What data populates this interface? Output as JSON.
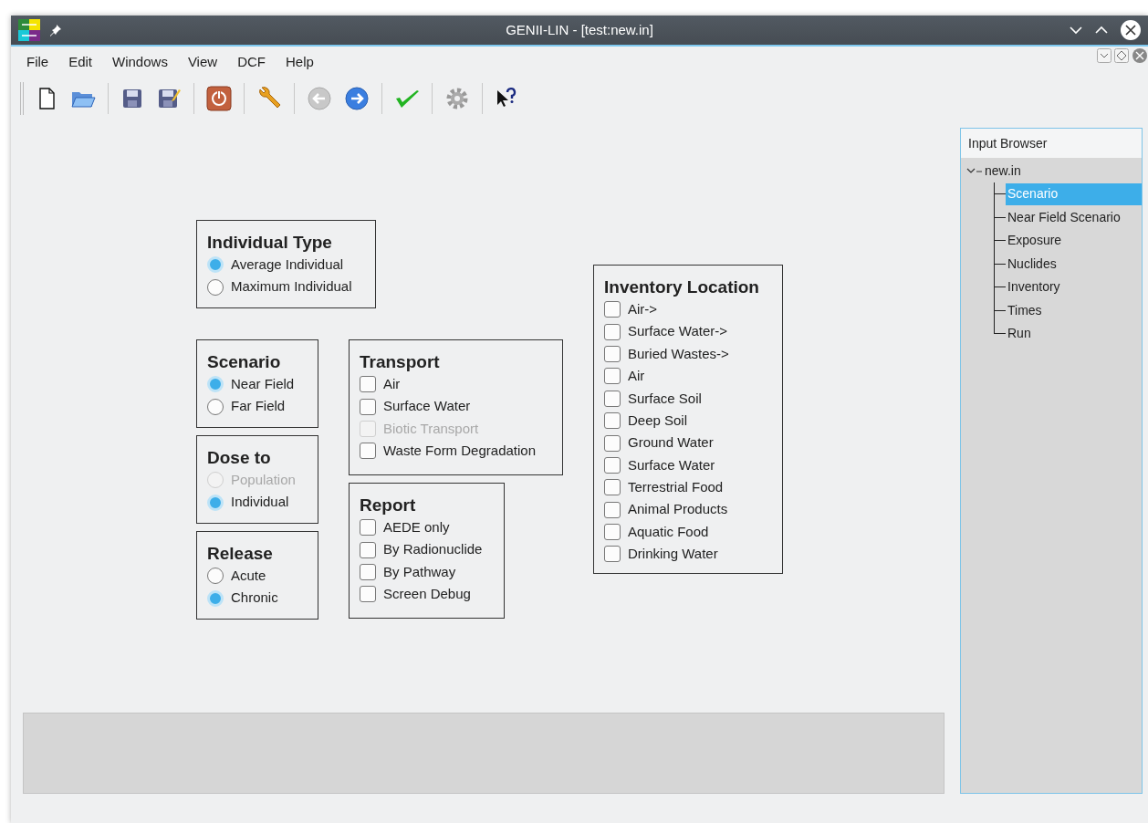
{
  "window": {
    "title": "GENII-LIN - [test:new.in]"
  },
  "menu": [
    "File",
    "Edit",
    "Windows",
    "View",
    "DCF",
    "Help"
  ],
  "groups": [
    {
      "title": "Individual Type",
      "kind": "radio",
      "options": [
        {
          "label": "Average Individual",
          "selected": true,
          "disabled": false
        },
        {
          "label": "Maximum Individual",
          "selected": false,
          "disabled": false
        }
      ]
    },
    {
      "title": "Scenario",
      "kind": "radio",
      "options": [
        {
          "label": "Near Field",
          "selected": true,
          "disabled": false
        },
        {
          "label": "Far Field",
          "selected": false,
          "disabled": false
        }
      ]
    },
    {
      "title": "Dose to",
      "kind": "radio",
      "options": [
        {
          "label": "Population",
          "selected": false,
          "disabled": true
        },
        {
          "label": "Individual",
          "selected": true,
          "disabled": false
        }
      ]
    },
    {
      "title": "Release",
      "kind": "radio",
      "options": [
        {
          "label": "Acute",
          "selected": false,
          "disabled": false
        },
        {
          "label": "Chronic",
          "selected": true,
          "disabled": false
        }
      ]
    },
    {
      "title": "Transport",
      "kind": "checkbox",
      "options": [
        {
          "label": "Air",
          "checked": false,
          "disabled": false
        },
        {
          "label": "Surface Water",
          "checked": false,
          "disabled": false
        },
        {
          "label": "Biotic Transport",
          "checked": false,
          "disabled": true
        },
        {
          "label": "Waste Form Degradation",
          "checked": false,
          "disabled": false
        }
      ]
    },
    {
      "title": "Report",
      "kind": "checkbox",
      "options": [
        {
          "label": "AEDE only",
          "checked": false,
          "disabled": false
        },
        {
          "label": "By Radionuclide",
          "checked": false,
          "disabled": false
        },
        {
          "label": "By Pathway",
          "checked": false,
          "disabled": false
        },
        {
          "label": "Screen Debug",
          "checked": false,
          "disabled": false
        }
      ]
    },
    {
      "title": "Inventory Location",
      "kind": "checkbox",
      "options": [
        {
          "label": "Air->",
          "checked": false,
          "disabled": false
        },
        {
          "label": "Surface Water->",
          "checked": false,
          "disabled": false
        },
        {
          "label": "Buried Wastes->",
          "checked": false,
          "disabled": false
        },
        {
          "label": "Air",
          "checked": false,
          "disabled": false
        },
        {
          "label": "Surface Soil",
          "checked": false,
          "disabled": false
        },
        {
          "label": "Deep Soil",
          "checked": false,
          "disabled": false
        },
        {
          "label": "Ground Water",
          "checked": false,
          "disabled": false
        },
        {
          "label": "Surface Water",
          "checked": false,
          "disabled": false
        },
        {
          "label": "Terrestrial Food",
          "checked": false,
          "disabled": false
        },
        {
          "label": "Animal Products",
          "checked": false,
          "disabled": false
        },
        {
          "label": "Aquatic Food",
          "checked": false,
          "disabled": false
        },
        {
          "label": "Drinking Water",
          "checked": false,
          "disabled": false
        }
      ]
    }
  ],
  "input_browser": {
    "title": "Input Browser",
    "tree": [
      {
        "label": "new.in",
        "expanded": true,
        "selected": false,
        "children": [
          {
            "label": "Scenario",
            "selected": true
          },
          {
            "label": "Near Field Scenario",
            "selected": false
          },
          {
            "label": "Exposure",
            "selected": false
          },
          {
            "label": "Nuclides",
            "selected": false
          },
          {
            "label": "Inventory",
            "selected": false
          },
          {
            "label": "Times",
            "selected": false
          },
          {
            "label": "Run",
            "selected": false
          }
        ]
      }
    ]
  }
}
